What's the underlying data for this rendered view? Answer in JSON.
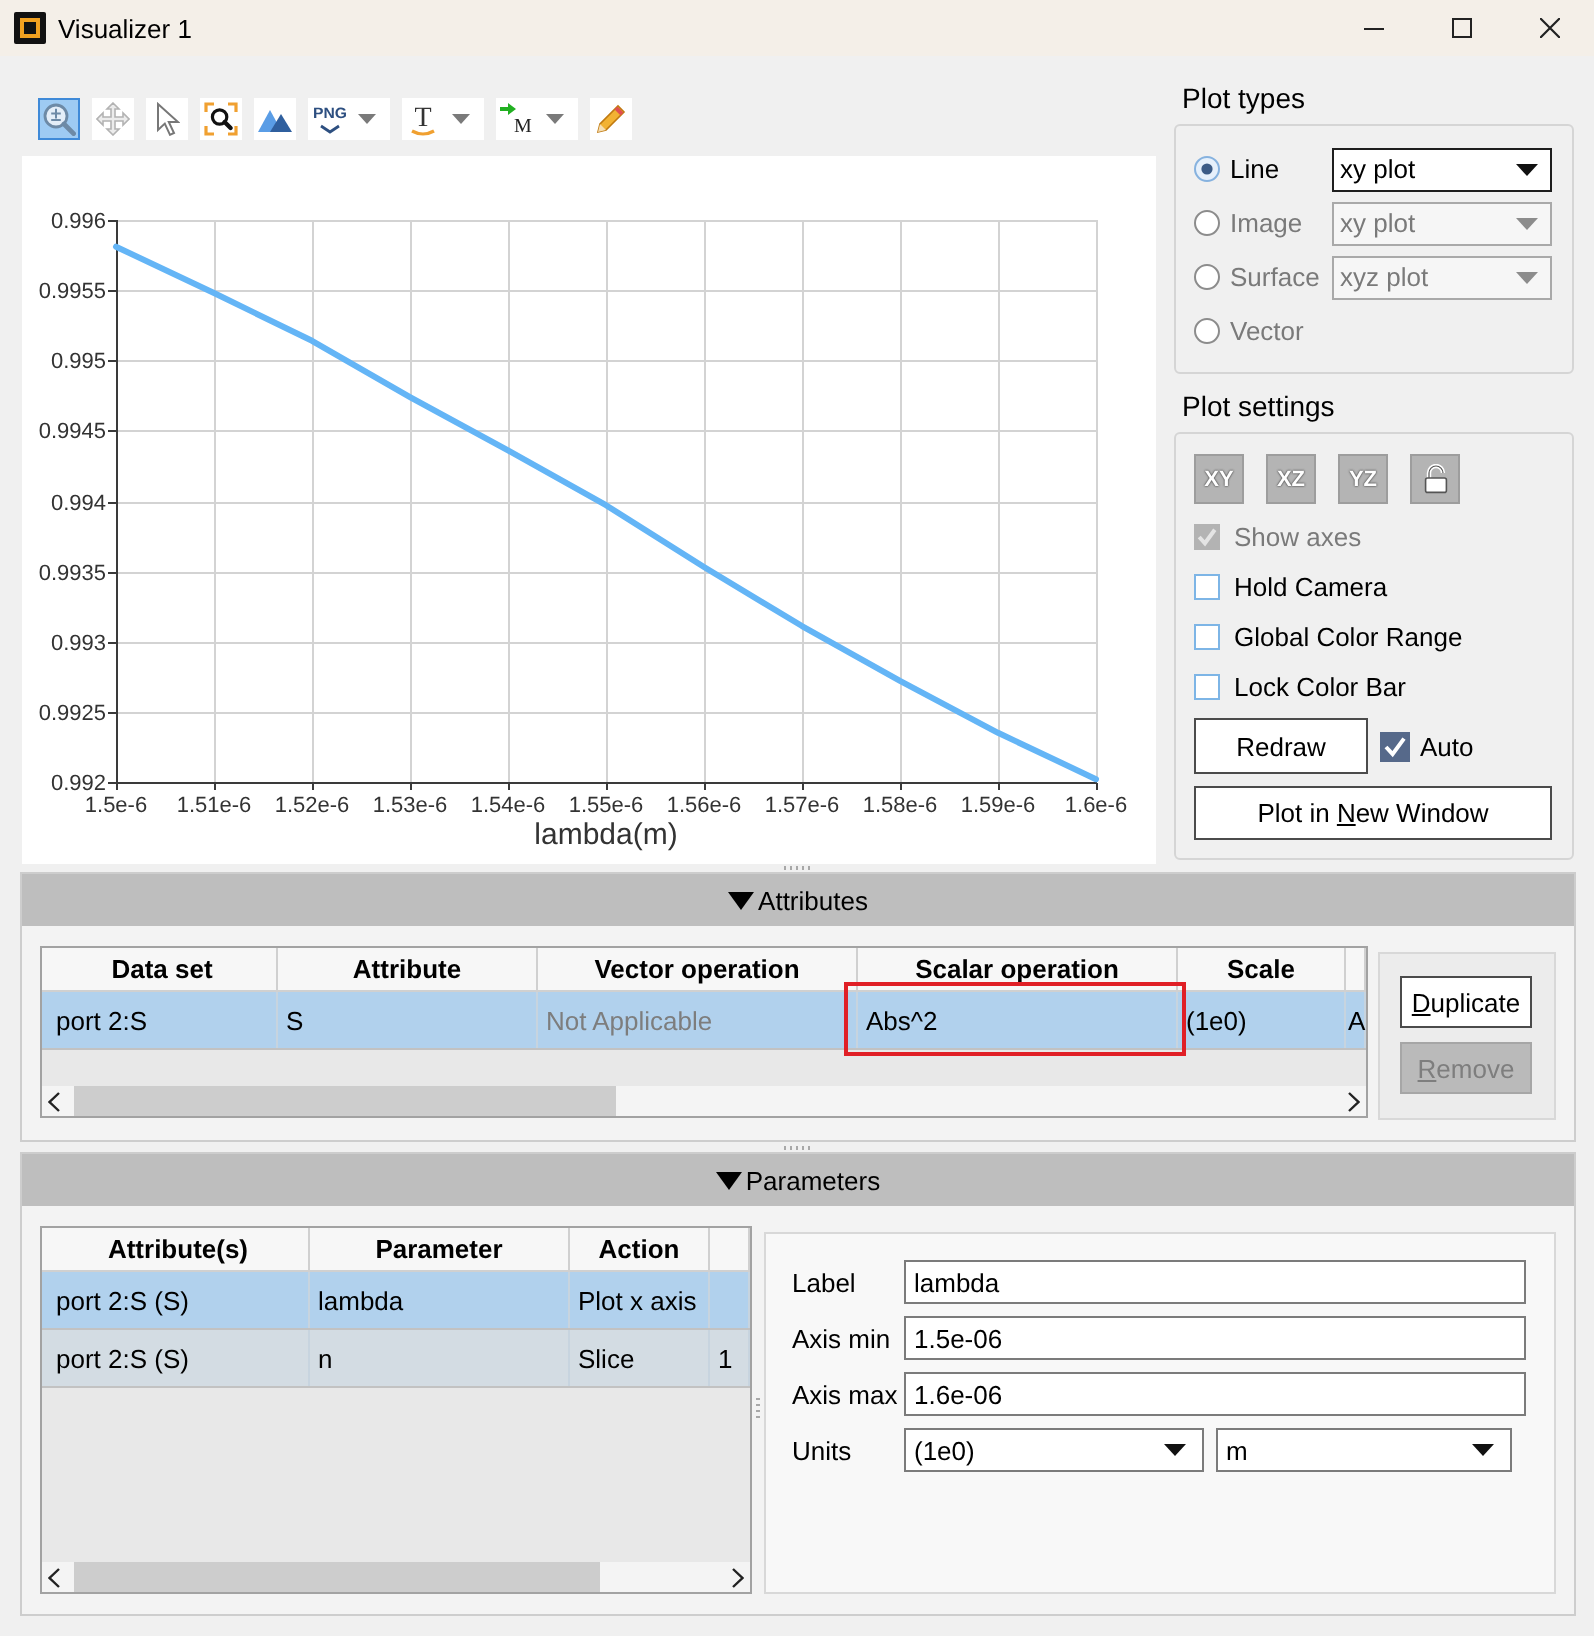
{
  "window": {
    "title": "Visualizer 1"
  },
  "toolbar": [
    {
      "kind": "zoom",
      "selected": true,
      "menu": false
    },
    {
      "kind": "pan",
      "selected": false,
      "menu": false
    },
    {
      "kind": "select",
      "selected": false,
      "menu": false
    },
    {
      "kind": "zoom_box",
      "selected": false,
      "menu": false
    },
    {
      "kind": "mountains",
      "selected": false,
      "menu": false
    },
    {
      "kind": "png",
      "glyph": "PNG",
      "selected": false,
      "menu": true
    },
    {
      "kind": "text",
      "glyph": "T",
      "selected": false,
      "menu": true
    },
    {
      "kind": "marker",
      "glyph": "M",
      "selected": false,
      "menu": true
    },
    {
      "kind": "pencil",
      "selected": false,
      "menu": false
    }
  ],
  "chart": {
    "chart_data": {
      "type": "line",
      "grid": true,
      "xlabel": "lambda(m)",
      "x": [
        1.5e-06,
        1.51e-06,
        1.52e-06,
        1.53e-06,
        1.54e-06,
        1.55e-06,
        1.56e-06,
        1.57e-06,
        1.58e-06,
        1.59e-06,
        1.6e-06
      ],
      "series": [
        {
          "color": "#64b5f6",
          "values": [
            0.99581,
            0.99548,
            0.99514,
            0.99474,
            0.99436,
            0.99397,
            0.99353,
            0.99311,
            0.99272,
            0.99235,
            0.99202
          ]
        }
      ],
      "xlim": [
        1.5e-06,
        1.6e-06
      ],
      "ylim": [
        0.992,
        0.996
      ],
      "xticks": [
        {
          "value": 1.5e-06,
          "label": "1.5e-6"
        },
        {
          "value": 1.51e-06,
          "label": "1.51e-6"
        },
        {
          "value": 1.52e-06,
          "label": "1.52e-6"
        },
        {
          "value": 1.53e-06,
          "label": "1.53e-6"
        },
        {
          "value": 1.54e-06,
          "label": "1.54e-6"
        },
        {
          "value": 1.55e-06,
          "label": "1.55e-6"
        },
        {
          "value": 1.56e-06,
          "label": "1.56e-6"
        },
        {
          "value": 1.57e-06,
          "label": "1.57e-6"
        },
        {
          "value": 1.58e-06,
          "label": "1.58e-6"
        },
        {
          "value": 1.59e-06,
          "label": "1.59e-6"
        },
        {
          "value": 1.6e-06,
          "label": "1.6e-6"
        }
      ],
      "yticks": [
        0.992,
        0.9925,
        0.993,
        0.9935,
        0.994,
        0.9945,
        0.995,
        0.9955,
        0.996
      ]
    }
  },
  "plot_types": {
    "title": "Plot types",
    "options": [
      {
        "label": "Line",
        "selected": true,
        "disabled": false,
        "dropdown": "xy plot"
      },
      {
        "label": "Image",
        "selected": false,
        "disabled": true,
        "dropdown": "xy plot"
      },
      {
        "label": "Surface",
        "selected": false,
        "disabled": true,
        "dropdown": "xyz plot"
      },
      {
        "label": "Vector",
        "selected": false,
        "disabled": true
      }
    ]
  },
  "plot_settings": {
    "title": "Plot settings",
    "view_buttons": [
      {
        "kind": "text",
        "label": "XY",
        "disabled": true
      },
      {
        "kind": "text",
        "label": "XZ",
        "disabled": true
      },
      {
        "kind": "text",
        "label": "YZ",
        "disabled": true
      },
      {
        "kind": "lock",
        "disabled": true
      }
    ],
    "options": [
      {
        "label": "Show axes",
        "checked": true,
        "disabled": true
      },
      {
        "label": "Hold Camera",
        "checked": false,
        "disabled": false
      },
      {
        "label": "Global Color Range",
        "checked": false,
        "disabled": false
      },
      {
        "label": "Lock Color Bar",
        "checked": false,
        "disabled": false
      }
    ],
    "redraw": {
      "label_parts": [
        {
          "text": "Redraw",
          "underlined": false
        }
      ]
    },
    "auto": {
      "label": "Auto",
      "checked": true
    },
    "new_window": {
      "label_parts": [
        {
          "text": "Plot in ",
          "underlined": false
        },
        {
          "text": "N",
          "underlined": true
        },
        {
          "text": "ew Window",
          "underlined": false
        }
      ]
    }
  },
  "attributes": {
    "title": "Attributes",
    "expanded": true,
    "table": {
      "columns": [
        "Data set",
        "Attribute",
        "Vector operation",
        "Scalar operation",
        "Scale"
      ],
      "rows": [
        {
          "selected": true,
          "cells": [
            {
              "text": "port 2:S",
              "disabled": false,
              "highlighted": false
            },
            {
              "text": "S",
              "disabled": false,
              "highlighted": false
            },
            {
              "text": "Not Applicable",
              "disabled": true,
              "highlighted": false
            },
            {
              "text": "Abs^2",
              "disabled": false,
              "highlighted": true
            },
            {
              "text": "(1e0)",
              "disabled": false,
              "highlighted": false
            },
            {
              "text": "A",
              "disabled": false,
              "highlighted": false
            }
          ]
        }
      ]
    },
    "buttons": [
      {
        "label_parts": [
          {
            "text": "D",
            "underlined": true
          },
          {
            "text": "uplicate",
            "underlined": false
          }
        ],
        "disabled": false
      },
      {
        "label_parts": [
          {
            "text": "R",
            "underlined": true
          },
          {
            "text": "emove",
            "underlined": false
          }
        ],
        "disabled": true
      }
    ]
  },
  "parameters": {
    "title": "Parameters",
    "expanded": true,
    "table": {
      "columns": [
        "Attribute(s)",
        "Parameter",
        "Action"
      ],
      "rows": [
        {
          "selected": true,
          "cells": [
            "port 2:S (S)",
            "lambda",
            "Plot x axis"
          ]
        },
        {
          "selected": false,
          "cells": [
            "port 2:S (S)",
            "n",
            "Slice",
            "1"
          ]
        }
      ]
    },
    "form": [
      {
        "kind": "text",
        "label": "Label",
        "value": "lambda"
      },
      {
        "kind": "text",
        "label": "Axis min",
        "value": "1.5e-06"
      },
      {
        "kind": "text",
        "label": "Axis max",
        "value": "1.6e-06"
      },
      {
        "kind": "select",
        "label": "Units",
        "values": [
          "(1e0)",
          "m"
        ]
      }
    ]
  }
}
